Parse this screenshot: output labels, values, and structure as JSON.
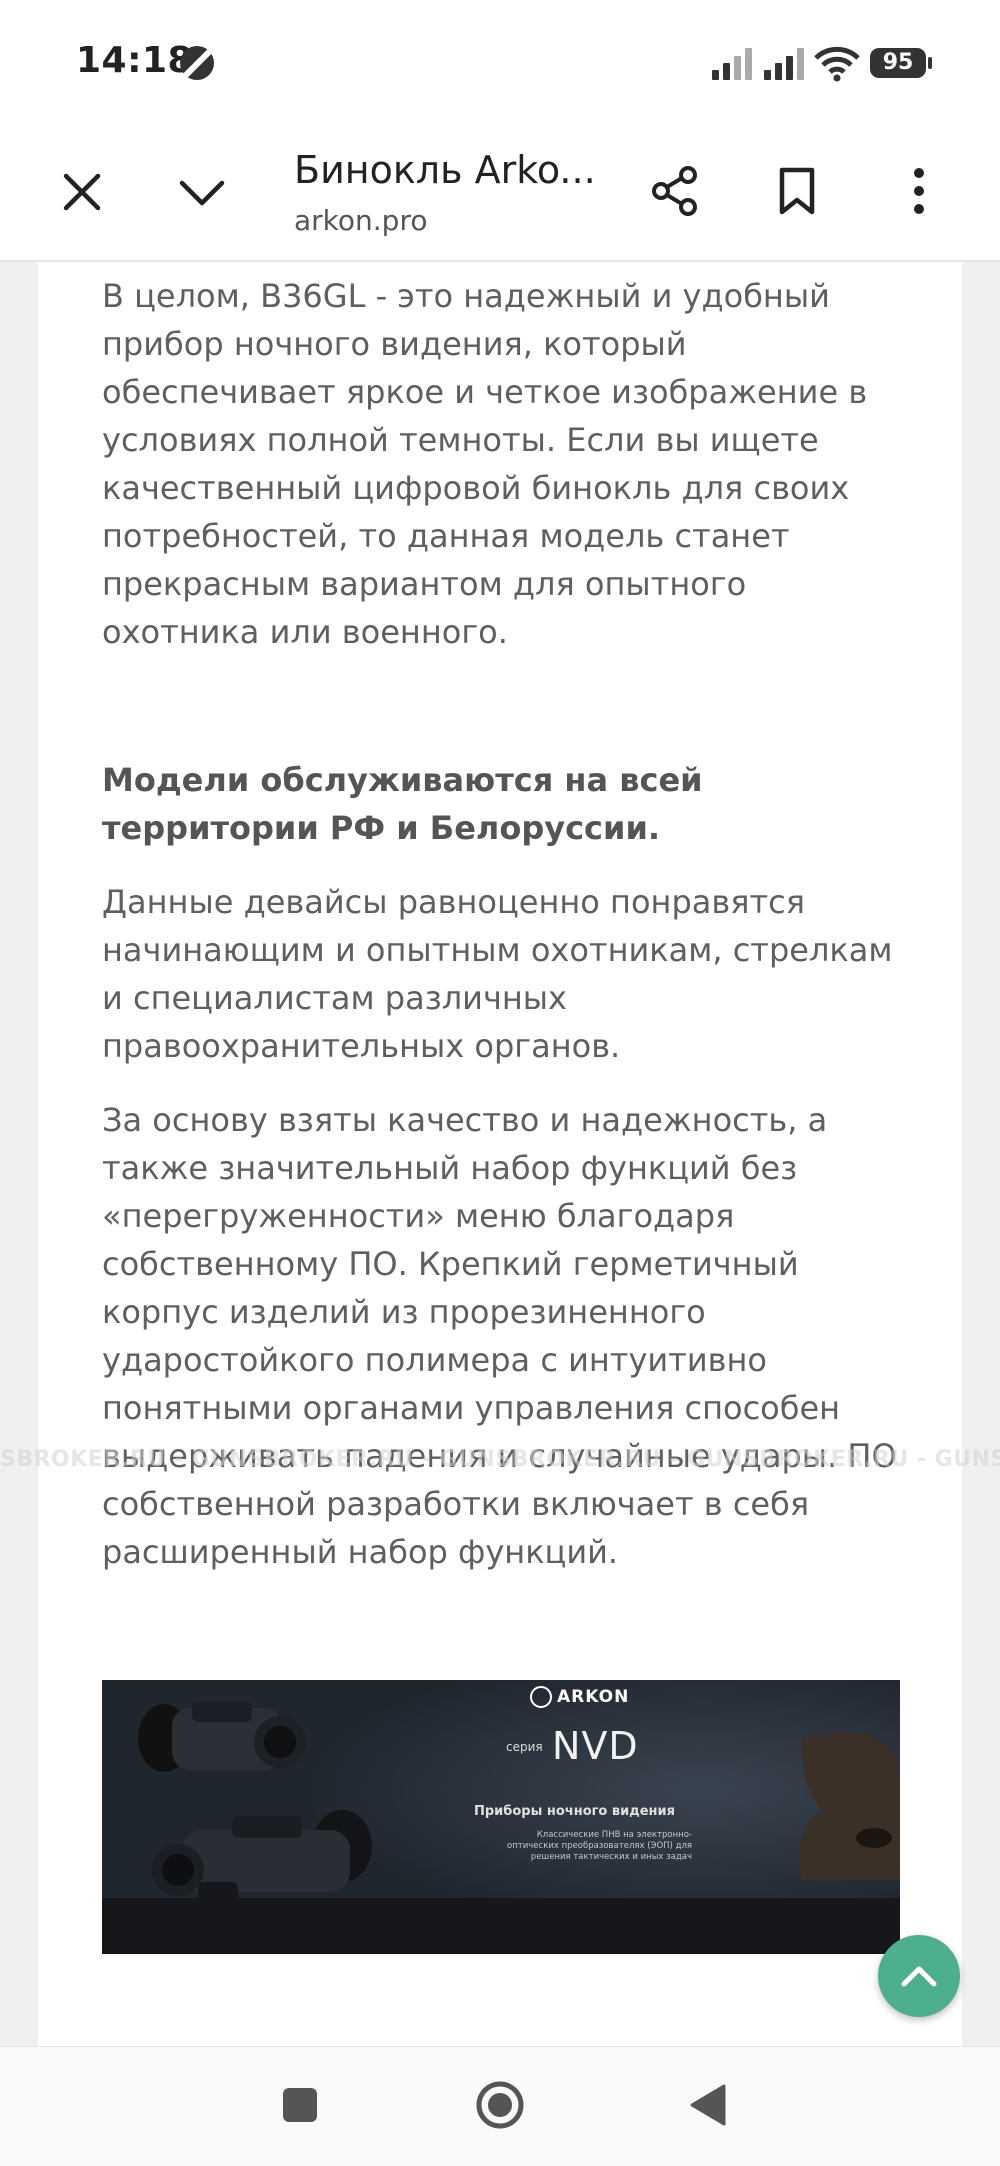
{
  "status_bar": {
    "time": "14:18",
    "battery": "95"
  },
  "app_bar": {
    "title": "Бинокль Arko...",
    "url": "arkon.pro"
  },
  "article": {
    "paragraph_1": "В целом, B36GL - это надежный и удобный прибор ночного видения, который обеспечивает яркое и четкое изображение в условиях полной темноты. Если вы ищете качественный цифровой бинокль для своих потребностей, то данная модель станет прекрасным вариантом для опытного охотника или военного.",
    "heading": "Модели обслуживаются на всей территории РФ и Белоруссии.",
    "paragraph_2": "Данные девайсы равноценно понравятся начинающим и опытным охотникам, стрелкам и специалистам различных правоохранительных органов.",
    "paragraph_3": "За основу взяты качество и надежность, а также значительный набор функций без «перегруженности» меню благодаря собственному ПО. Крепкий герметичный корпус изделий из прорезиненного ударостойкого полимера с интуитивно понятными органами управления способен выдерживать падения и случайные удары. ПО собственной разработки включает в себя расширенный набор функций."
  },
  "banner": {
    "brand": "ARKON",
    "series_label": "серия",
    "series_name": "NVD",
    "subtitle": "Приборы ночного видения",
    "description": "Классические ПНВ на электронно-оптических преобразователях (ЭОП) для решения тактических и иных задач"
  },
  "watermark": "SBROKER.RU - GUNSBROKER.RU - GUNSBROKER.RU - GUNSBROKER.RU - GUNSBROKER.RU - GUNSB",
  "colors": {
    "fab": "#4eaf8d",
    "text": "#5f5f5f",
    "background": "#f0f0f0"
  },
  "icons": {
    "close": "close-icon",
    "collapse": "chevron-down-icon",
    "share": "share-icon",
    "bookmark": "bookmark-icon",
    "menu": "more-vert-icon",
    "scroll_top": "chevron-up-icon",
    "nav_recents": "square-icon",
    "nav_home": "circle-icon",
    "nav_back": "triangle-back-icon"
  }
}
